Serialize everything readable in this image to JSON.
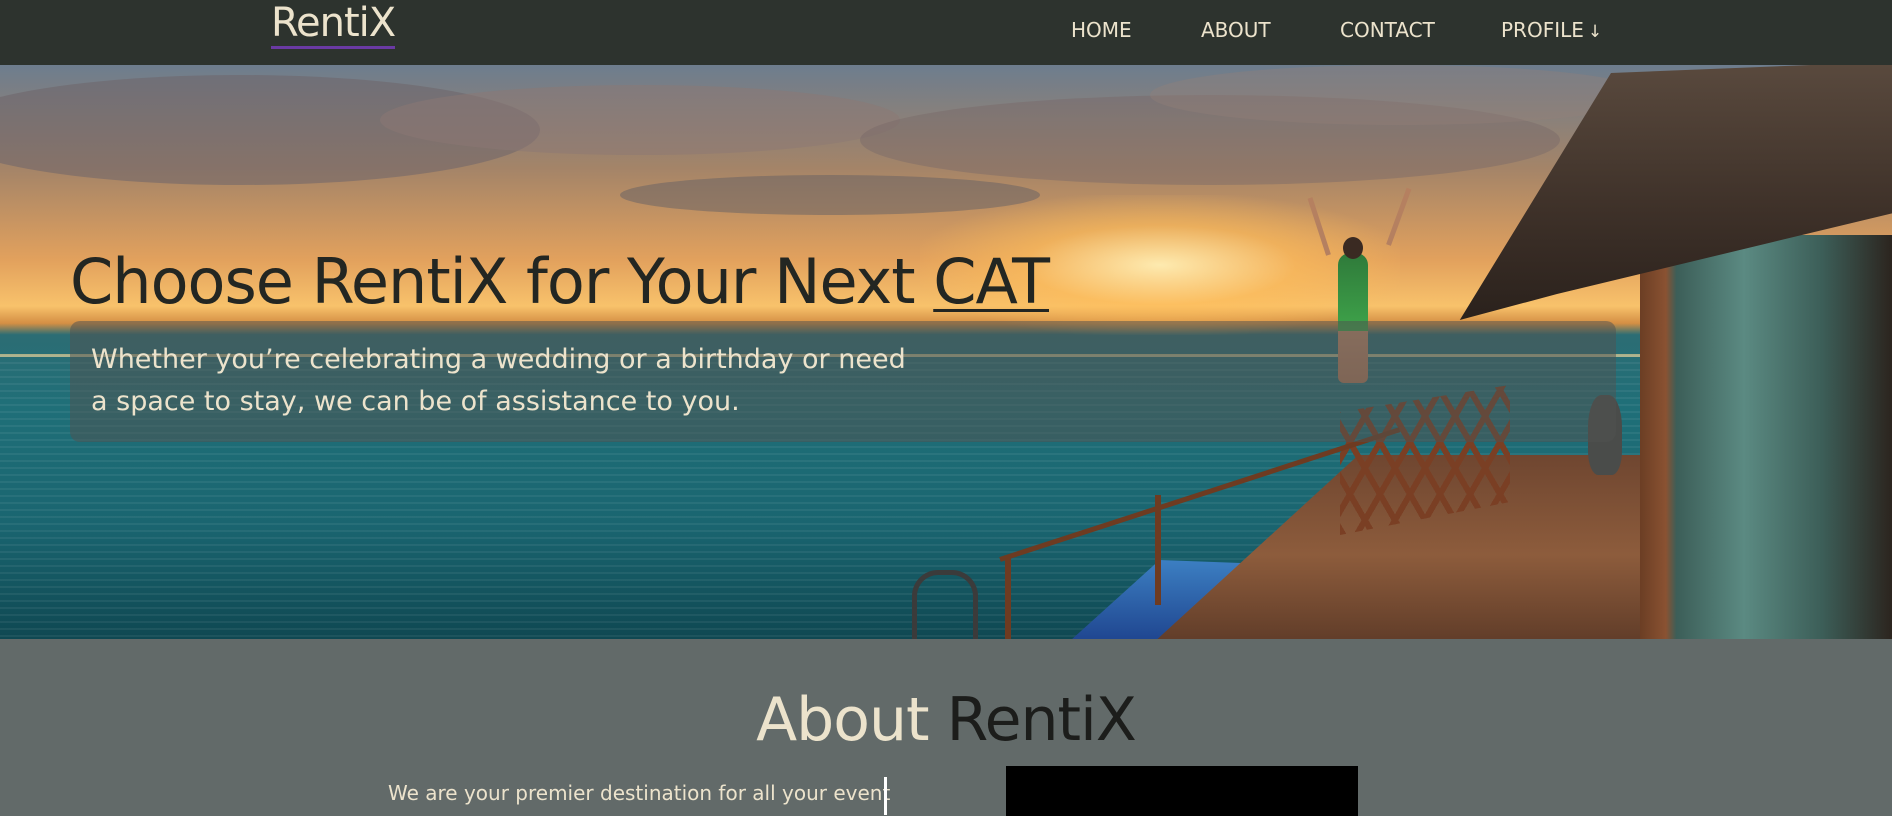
{
  "header": {
    "logo": "RentiX",
    "nav": {
      "home": "HOME",
      "about": "ABOUT",
      "contact": "CONTACT",
      "profile": "PROFILE",
      "profile_icon": "↓"
    }
  },
  "hero": {
    "title_prefix": "Choose RentiX for Your Next ",
    "title_highlight": "CAT",
    "subtitle": "Whether you’re celebrating a wedding or a birthday or need a space to stay, we can be of assistance to you."
  },
  "about": {
    "title_accent": "About",
    "title_rest": " RentiX",
    "text": "We are your premier destination for all your event"
  },
  "colors": {
    "navbar_bg": "#2d332e",
    "cream": "#ece3cc",
    "about_bg": "#626a69",
    "logo_underline": "#6a3aa3"
  }
}
